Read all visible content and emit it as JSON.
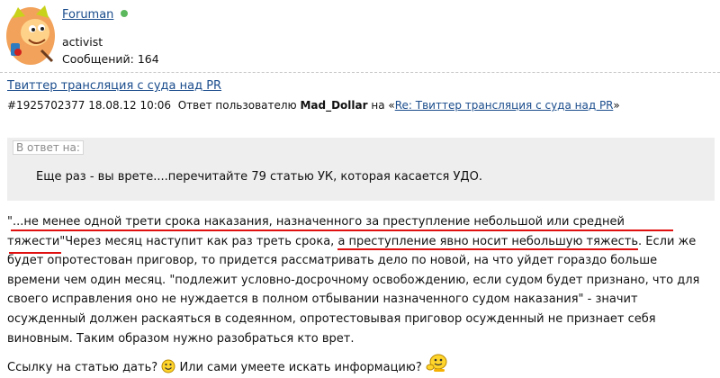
{
  "profile": {
    "username": "Foruman",
    "rank": "activist",
    "posts_label": "Сообщений:",
    "posts_count": "164"
  },
  "thread": {
    "title": "Твиттер трансляция с суда над PR"
  },
  "meta": {
    "post_id": "#1925702377",
    "date": "18.08.12 10:06",
    "reply_to_text": "Ответ пользователю",
    "reply_to_user": "Mad_Dollar",
    "on_text": "на «",
    "reply_link": "Re: Твиттер трансляция с суда над PR",
    "close_quote": "»"
  },
  "quote": {
    "label": "В ответ на:",
    "text": "Еще раз - вы врете....перечитайте 79 статью УК, которая касается УДО."
  },
  "body": {
    "p1_a": "\"...",
    "p1_b": "не менее одной трети срока наказания, назначенного за преступление небольшой или средней",
    "p1_c": "тяжести",
    "p1_d": "\"Через месяц наступит как раз треть срока, ",
    "p1_e": "а преступление явно носит небольшую тяжесть",
    "p1_f": ". Если же будет опротестован приговор, то придется рассматривать дело по новой, на что уйдет гораздо больше времени чем один месяц. \"подлежит условно-досрочному освобождению, если судом будет признано, что для своего исправления оно не нуждается в полном отбывании назначенного судом наказания\" - значит осужденный должен раскаяться в содеянном, опротестовывая приговор осужденный не признает себя виновным. Таким образом нужно разобраться кто врет.",
    "p2_a": "Ссылку на статью дать?",
    "p2_b": " Или сами умеете искать информацию?",
    "p2_c": " "
  },
  "colors": {
    "link": "#1a4c8c",
    "online": "#5cb85c",
    "annotation": "#e01010",
    "quote_bg": "#eeeeee"
  },
  "icons": [
    "avatar-cartoon",
    "online-status-dot",
    "smiley-icon",
    "nod-smiley-icon"
  ]
}
